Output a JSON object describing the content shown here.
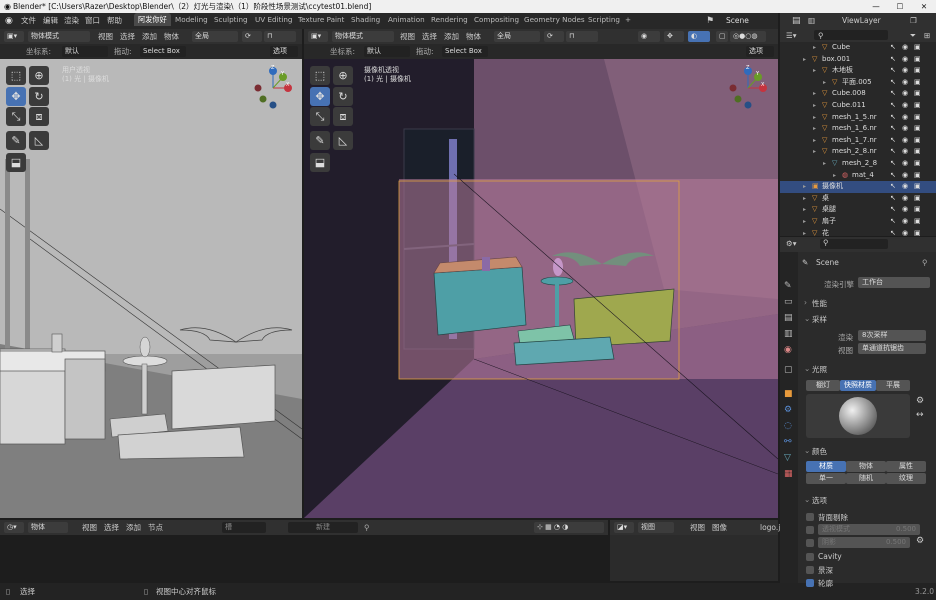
{
  "titlebar": {
    "title": "Blender* [C:\\Users\\Razer\\Desktop\\Blender\\（2）灯光与渲染\\（1）阶段性场景测试\\ccytest01.blend]",
    "minimize": "—",
    "maximize": "☐",
    "close": "✕"
  },
  "menu": {
    "items": [
      "文件",
      "编辑",
      "渲染",
      "窗口",
      "帮助"
    ]
  },
  "workspaces": [
    "阿发你好",
    "Modeling",
    "Sculpting",
    "UV Editing",
    "Texture Paint",
    "Shading",
    "Animation",
    "Rendering",
    "Compositing",
    "Geometry Nodes",
    "Scripting"
  ],
  "workspace_add": "+",
  "scene": {
    "label": "Scene",
    "viewlayer": "ViewLayer"
  },
  "viewport_left": {
    "mode": "物体模式",
    "menus": [
      "视图",
      "选择",
      "添加",
      "物体"
    ],
    "transform": "全局",
    "coord_label": "坐标系:",
    "coord_value": "默认",
    "drag_label": "拖动:",
    "drag_value": "Select Box",
    "options": "选项",
    "overlay_line1": "用户透视",
    "overlay_line2": "(1) 光 | 摄像机"
  },
  "viewport_right": {
    "mode": "物体模式",
    "menus": [
      "视图",
      "选择",
      "添加",
      "物体"
    ],
    "transform": "全局",
    "coord_label": "坐标系:",
    "coord_value": "默认",
    "drag_label": "拖动:",
    "drag_value": "Select Box",
    "options": "选项",
    "overlay_line1": "摄像机透视",
    "overlay_line2": "(1) 光 | 摄像机"
  },
  "gizmo_axes": {
    "x": "X",
    "y": "Y",
    "z": "Z"
  },
  "colors": {
    "x_axis": "#c5343f",
    "y_axis": "#6a9c27",
    "z_axis": "#2f6bbd",
    "accent": "#4772b3",
    "camera_frame": "#e0a040"
  },
  "outliner": {
    "rows": [
      {
        "name": "Cube",
        "indent": 2,
        "icon": "mesh"
      },
      {
        "name": "box.001",
        "indent": 1,
        "icon": "mesh"
      },
      {
        "name": "木地板",
        "indent": 2,
        "icon": "mesh"
      },
      {
        "name": "平面.005",
        "indent": 3,
        "icon": "mesh"
      },
      {
        "name": "Cube.008",
        "indent": 2,
        "icon": "mesh"
      },
      {
        "name": "Cube.011",
        "indent": 2,
        "icon": "mesh"
      },
      {
        "name": "mesh_1_5.nr",
        "indent": 2,
        "icon": "mesh"
      },
      {
        "name": "mesh_1_6.nr",
        "indent": 2,
        "icon": "mesh"
      },
      {
        "name": "mesh_1_7.nr",
        "indent": 2,
        "icon": "mesh"
      },
      {
        "name": "mesh_2_8.nr",
        "indent": 2,
        "icon": "mesh"
      },
      {
        "name": "mesh_2_8",
        "indent": 3,
        "icon": "data"
      },
      {
        "name": "mat_4",
        "indent": 4,
        "icon": "material"
      },
      {
        "name": "摄像机",
        "indent": 1,
        "icon": "camera",
        "highlight": true
      },
      {
        "name": "桌",
        "indent": 1,
        "icon": "mesh"
      },
      {
        "name": "桌腿",
        "indent": 1,
        "icon": "mesh"
      },
      {
        "name": "扇子",
        "indent": 1,
        "icon": "mesh"
      },
      {
        "name": "花",
        "indent": 1,
        "icon": "mesh"
      }
    ]
  },
  "properties": {
    "scene_name": "Scene",
    "render_engine_label": "渲染引擎",
    "render_engine_value": "工作台",
    "sections": {
      "performance": "性能",
      "sampling": "采样",
      "lighting": "光照",
      "color": "颜色",
      "options": "选项"
    },
    "sampling": {
      "render_label": "渲染",
      "render_value": "8次采样",
      "viewport_label": "视图",
      "viewport_value": "单通道抗锯齿"
    },
    "lighting_buttons": [
      "棚灯",
      "快照材质",
      "平展"
    ],
    "color_buttons": [
      "材质",
      "物体",
      "属性",
      "单一",
      "随机",
      "纹理"
    ],
    "options": {
      "backface": "背面剔除",
      "xray_label": "透视模式",
      "xray_value": "0.500",
      "shadow_label": "阴影",
      "shadow_value": "0.500",
      "cavity": "Cavity",
      "dof": "景深",
      "outline": "轮廓"
    }
  },
  "bottom_left": {
    "mode": "物体",
    "menus": [
      "视图",
      "选择",
      "添加",
      "节点"
    ],
    "slot": "槽",
    "new": "新建"
  },
  "bottom_right": {
    "menus": [
      "视图",
      "图像"
    ],
    "image": "logo.j"
  },
  "statusbar": {
    "left": "选择",
    "middle": "视图中心对齐鼠标",
    "version": "3.2.0"
  }
}
